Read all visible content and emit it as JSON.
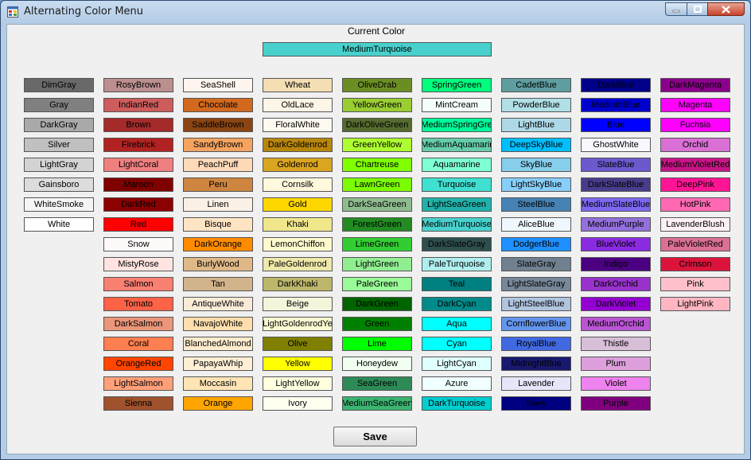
{
  "window": {
    "title": "Alternating Color Menu"
  },
  "current": {
    "label": "Current Color",
    "name": "MediumTurquoise",
    "color": "#48D1CC"
  },
  "save_label": "Save",
  "columns": [
    [
      {
        "name": "DimGray",
        "color": "#696969"
      },
      {
        "name": "Gray",
        "color": "#808080"
      },
      {
        "name": "DarkGray",
        "color": "#A9A9A9"
      },
      {
        "name": "Silver",
        "color": "#C0C0C0"
      },
      {
        "name": "LightGray",
        "color": "#D3D3D3"
      },
      {
        "name": "Gainsboro",
        "color": "#DCDCDC"
      },
      {
        "name": "WhiteSmoke",
        "color": "#F5F5F5"
      },
      {
        "name": "White",
        "color": "#FFFFFF"
      }
    ],
    [
      {
        "name": "RosyBrown",
        "color": "#BC8F8F"
      },
      {
        "name": "IndianRed",
        "color": "#CD5C5C"
      },
      {
        "name": "Brown",
        "color": "#A52A2A"
      },
      {
        "name": "Firebrick",
        "color": "#B22222"
      },
      {
        "name": "LightCoral",
        "color": "#F08080"
      },
      {
        "name": "Maroon",
        "color": "#800000"
      },
      {
        "name": "DarkRed",
        "color": "#8B0000"
      },
      {
        "name": "Red",
        "color": "#FF0000"
      },
      {
        "name": "Snow",
        "color": "#FFFAFA"
      },
      {
        "name": "MistyRose",
        "color": "#FFE4E1"
      },
      {
        "name": "Salmon",
        "color": "#FA8072"
      },
      {
        "name": "Tomato",
        "color": "#FF6347"
      },
      {
        "name": "DarkSalmon",
        "color": "#E9967A"
      },
      {
        "name": "Coral",
        "color": "#FF7F50"
      },
      {
        "name": "OrangeRed",
        "color": "#FF4500"
      },
      {
        "name": "LightSalmon",
        "color": "#FFA07A"
      },
      {
        "name": "Sienna",
        "color": "#A0522D"
      }
    ],
    [
      {
        "name": "SeaShell",
        "color": "#FFF5EE"
      },
      {
        "name": "Chocolate",
        "color": "#D2691E"
      },
      {
        "name": "SaddleBrown",
        "color": "#8B4513"
      },
      {
        "name": "SandyBrown",
        "color": "#F4A460"
      },
      {
        "name": "PeachPuff",
        "color": "#FFDAB9"
      },
      {
        "name": "Peru",
        "color": "#CD853F"
      },
      {
        "name": "Linen",
        "color": "#FAF0E6"
      },
      {
        "name": "Bisque",
        "color": "#FFE4C4"
      },
      {
        "name": "DarkOrange",
        "color": "#FF8C00"
      },
      {
        "name": "BurlyWood",
        "color": "#DEB887"
      },
      {
        "name": "Tan",
        "color": "#D2B48C"
      },
      {
        "name": "AntiqueWhite",
        "color": "#FAEBD7"
      },
      {
        "name": "NavajoWhite",
        "color": "#FFDEAD"
      },
      {
        "name": "BlanchedAlmond",
        "color": "#FFEBCD"
      },
      {
        "name": "PapayaWhip",
        "color": "#FFEFD5"
      },
      {
        "name": "Moccasin",
        "color": "#FFE4B5"
      },
      {
        "name": "Orange",
        "color": "#FFA500"
      }
    ],
    [
      {
        "name": "Wheat",
        "color": "#F5DEB3"
      },
      {
        "name": "OldLace",
        "color": "#FDF5E6"
      },
      {
        "name": "FloralWhite",
        "color": "#FFFAF0"
      },
      {
        "name": "DarkGoldenrod",
        "color": "#B8860B"
      },
      {
        "name": "Goldenrod",
        "color": "#DAA520"
      },
      {
        "name": "Cornsilk",
        "color": "#FFF8DC"
      },
      {
        "name": "Gold",
        "color": "#FFD700"
      },
      {
        "name": "Khaki",
        "color": "#F0E68C"
      },
      {
        "name": "LemonChiffon",
        "color": "#FFFACD"
      },
      {
        "name": "PaleGoldenrod",
        "color": "#EEE8AA"
      },
      {
        "name": "DarkKhaki",
        "color": "#BDB76B"
      },
      {
        "name": "Beige",
        "color": "#F5F5DC"
      },
      {
        "name": "LightGoldenrodYe",
        "color": "#FAFAD2"
      },
      {
        "name": "Olive",
        "color": "#808000"
      },
      {
        "name": "Yellow",
        "color": "#FFFF00"
      },
      {
        "name": "LightYellow",
        "color": "#FFFFE0"
      },
      {
        "name": "Ivory",
        "color": "#FFFFF0"
      }
    ],
    [
      {
        "name": "OliveDrab",
        "color": "#6B8E23"
      },
      {
        "name": "YellowGreen",
        "color": "#9ACD32"
      },
      {
        "name": "DarkOliveGreen",
        "color": "#556B2F"
      },
      {
        "name": "GreenYellow",
        "color": "#ADFF2F"
      },
      {
        "name": "Chartreuse",
        "color": "#7FFF00"
      },
      {
        "name": "LawnGreen",
        "color": "#7CFC00"
      },
      {
        "name": "DarkSeaGreen",
        "color": "#8FBC8F"
      },
      {
        "name": "ForestGreen",
        "color": "#228B22"
      },
      {
        "name": "LimeGreen",
        "color": "#32CD32"
      },
      {
        "name": "LightGreen",
        "color": "#90EE90"
      },
      {
        "name": "PaleGreen",
        "color": "#98FB98"
      },
      {
        "name": "DarkGreen",
        "color": "#006400"
      },
      {
        "name": "Green",
        "color": "#008000"
      },
      {
        "name": "Lime",
        "color": "#00FF00"
      },
      {
        "name": "Honeydew",
        "color": "#F0FFF0"
      },
      {
        "name": "SeaGreen",
        "color": "#2E8B57"
      },
      {
        "name": "MediumSeaGreen",
        "color": "#3CB371"
      }
    ],
    [
      {
        "name": "SpringGreen",
        "color": "#00FF7F"
      },
      {
        "name": "MintCream",
        "color": "#F5FFFA"
      },
      {
        "name": "MediumSpringGre",
        "color": "#00FA9A"
      },
      {
        "name": "MediumAquamarir",
        "color": "#66CDAA"
      },
      {
        "name": "Aquamarine",
        "color": "#7FFFD4"
      },
      {
        "name": "Turquoise",
        "color": "#40E0D0"
      },
      {
        "name": "LightSeaGreen",
        "color": "#20B2AA"
      },
      {
        "name": "MediumTurquoise",
        "color": "#48D1CC"
      },
      {
        "name": "DarkSlateGray",
        "color": "#2F4F4F"
      },
      {
        "name": "PaleTurquoise",
        "color": "#AFEEEE"
      },
      {
        "name": "Teal",
        "color": "#008080"
      },
      {
        "name": "DarkCyan",
        "color": "#008B8B"
      },
      {
        "name": "Aqua",
        "color": "#00FFFF"
      },
      {
        "name": "Cyan",
        "color": "#00FFFF"
      },
      {
        "name": "LightCyan",
        "color": "#E0FFFF"
      },
      {
        "name": "Azure",
        "color": "#F0FFFF"
      },
      {
        "name": "DarkTurquoise",
        "color": "#00CED1"
      }
    ],
    [
      {
        "name": "CadetBlue",
        "color": "#5F9EA0"
      },
      {
        "name": "PowderBlue",
        "color": "#B0E0E6"
      },
      {
        "name": "LightBlue",
        "color": "#ADD8E6"
      },
      {
        "name": "DeepSkyBlue",
        "color": "#00BFFF"
      },
      {
        "name": "SkyBlue",
        "color": "#87CEEB"
      },
      {
        "name": "LightSkyBlue",
        "color": "#87CEFA"
      },
      {
        "name": "SteelBlue",
        "color": "#4682B4"
      },
      {
        "name": "AliceBlue",
        "color": "#F0F8FF"
      },
      {
        "name": "DodgerBlue",
        "color": "#1E90FF"
      },
      {
        "name": "SlateGray",
        "color": "#708090"
      },
      {
        "name": "LightSlateGray",
        "color": "#778899"
      },
      {
        "name": "LightSteelBlue",
        "color": "#B0C4DE"
      },
      {
        "name": "CornflowerBlue",
        "color": "#6495ED"
      },
      {
        "name": "RoyalBlue",
        "color": "#4169E1"
      },
      {
        "name": "MidnightBlue",
        "color": "#191970"
      },
      {
        "name": "Lavender",
        "color": "#E6E6FA"
      },
      {
        "name": "Navy",
        "color": "#000080"
      }
    ],
    [
      {
        "name": "DarkBlue",
        "color": "#00008B"
      },
      {
        "name": "MediumBlue",
        "color": "#0000CD"
      },
      {
        "name": "Blue",
        "color": "#0000FF"
      },
      {
        "name": "GhostWhite",
        "color": "#F8F8FF"
      },
      {
        "name": "SlateBlue",
        "color": "#6A5ACD"
      },
      {
        "name": "DarkSlateBlue",
        "color": "#483D8B"
      },
      {
        "name": "MediumSlateBlue",
        "color": "#7B68EE"
      },
      {
        "name": "MediumPurple",
        "color": "#9370DB"
      },
      {
        "name": "BlueViolet",
        "color": "#8A2BE2"
      },
      {
        "name": "Indigo",
        "color": "#4B0082"
      },
      {
        "name": "DarkOrchid",
        "color": "#9932CC"
      },
      {
        "name": "DarkViolet",
        "color": "#9400D3"
      },
      {
        "name": "MediumOrchid",
        "color": "#BA55D3"
      },
      {
        "name": "Thistle",
        "color": "#D8BFD8"
      },
      {
        "name": "Plum",
        "color": "#DDA0DD"
      },
      {
        "name": "Violet",
        "color": "#EE82EE"
      },
      {
        "name": "Purple",
        "color": "#800080"
      }
    ],
    [
      {
        "name": "DarkMagenta",
        "color": "#8B008B"
      },
      {
        "name": "Magenta",
        "color": "#FF00FF"
      },
      {
        "name": "Fuchsia",
        "color": "#FF00FF"
      },
      {
        "name": "Orchid",
        "color": "#DA70D6"
      },
      {
        "name": "MediumVioletRed",
        "color": "#C71585"
      },
      {
        "name": "DeepPink",
        "color": "#FF1493"
      },
      {
        "name": "HotPink",
        "color": "#FF69B4"
      },
      {
        "name": "LavenderBlush",
        "color": "#FFF0F5"
      },
      {
        "name": "PaleVioletRed",
        "color": "#DB7093"
      },
      {
        "name": "Crimson",
        "color": "#DC143C"
      },
      {
        "name": "Pink",
        "color": "#FFC0CB"
      },
      {
        "name": "LightPink",
        "color": "#FFB6C1"
      }
    ]
  ]
}
